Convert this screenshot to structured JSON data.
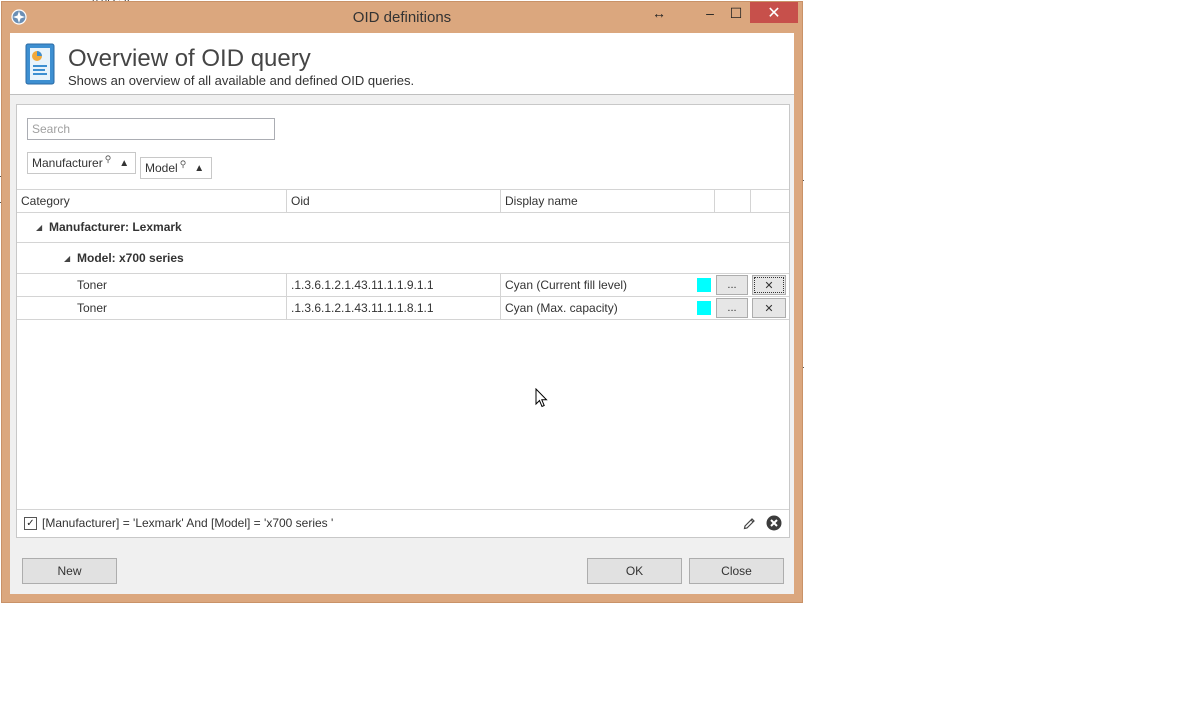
{
  "window": {
    "title": "OID definitions",
    "buttons": {
      "resize": "↔",
      "minimize": "–",
      "maximize": "☐",
      "close": "✕"
    }
  },
  "header": {
    "title": "Overview of OID query",
    "subtitle": "Shows an overview of all available and defined OID queries.",
    "icon": "report-icon"
  },
  "search": {
    "placeholder": "Search",
    "value": ""
  },
  "group_chips": [
    {
      "label": "Manufacturer",
      "filter_glyph": "⚲",
      "sort_glyph": "▲"
    },
    {
      "label": "Model",
      "filter_glyph": "⚲",
      "sort_glyph": "▲"
    }
  ],
  "grid": {
    "columns": [
      "Category",
      "Oid",
      "Display name",
      "",
      ""
    ],
    "groups": [
      {
        "label": "Manufacturer: Lexmark",
        "subgroups": [
          {
            "label": "Model: x700 series",
            "rows": [
              {
                "category": "Toner",
                "oid": ".1.3.6.1.2.1.43.11.1.1.9.1.1",
                "display_name": "Cyan (Current fill level)",
                "color": "#00ffff",
                "edit_label": "...",
                "delete_label": "✕"
              },
              {
                "category": "Toner",
                "oid": ".1.3.6.1.2.1.43.11.1.1.8.1.1",
                "display_name": "Cyan (Max. capacity)",
                "color": "#00ffff",
                "edit_label": "...",
                "delete_label": "✕"
              }
            ]
          }
        ]
      }
    ],
    "toggle_glyph": "◢"
  },
  "filter": {
    "checked": true,
    "check_glyph": "✓",
    "expression": "[Manufacturer] = 'Lexmark' And [Model] = 'x700 series '"
  },
  "footer": {
    "new_label": "New",
    "ok_label": "OK",
    "close_label": "Close"
  },
  "colors": {
    "title_bar": "#dba77e",
    "close_button": "#c7504b",
    "swatch": "#00ffff"
  }
}
